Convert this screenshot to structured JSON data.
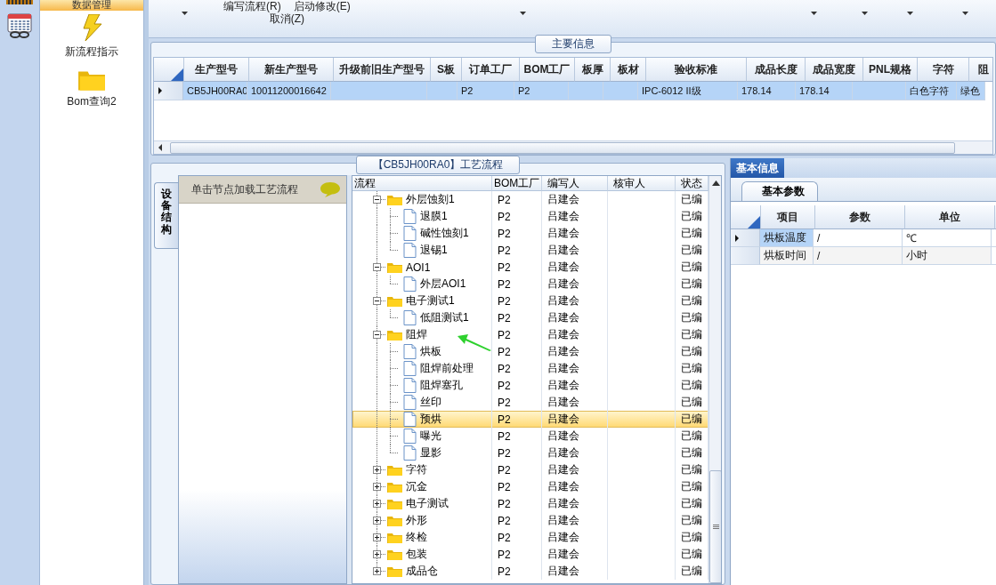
{
  "nav": {
    "header": "数据管理",
    "items": [
      {
        "kind": "bolt",
        "label": "新流程指示"
      },
      {
        "kind": "folder",
        "label": "Bom查询2"
      }
    ]
  },
  "ribbon": {
    "commands": [
      {
        "label": "编写流程(R)"
      },
      {
        "label": "启动修改(E)"
      },
      {
        "label": "取消(Z)"
      }
    ]
  },
  "main_info": {
    "title": "主要信息",
    "columns": [
      "生产型号",
      "新生产型号",
      "升级前旧生产型号",
      "S板",
      "订单工厂",
      "BOM工厂",
      "板厚",
      "板材",
      "验收标准",
      "成品长度",
      "成品宽度",
      "PNL规格",
      "字符",
      "阻"
    ],
    "rows": [
      {
        "selected": true,
        "cells": [
          "CB5JH00RA0",
          "10011200016642",
          "",
          "",
          "P2",
          "P2",
          "",
          "",
          "IPC-6012 II级",
          "178.14",
          "178.14",
          "",
          "白色字符",
          "绿色"
        ]
      }
    ]
  },
  "process": {
    "title": "【CB5JH00RA0】工艺流程",
    "side_tab": "设备结构",
    "hint": "单击节点加载工艺流程",
    "columns": [
      "流程",
      "BOM工厂",
      "编写人",
      "核审人",
      "状态"
    ],
    "tree": [
      {
        "name": "外层蚀刻1",
        "bom": "P2",
        "writer": "吕建会",
        "status": "已编",
        "selected": false,
        "expanded": true,
        "children": [
          {
            "name": "退膜1",
            "bom": "P2",
            "writer": "吕建会",
            "status": "已编",
            "selected": false
          },
          {
            "name": "碱性蚀刻1",
            "bom": "P2",
            "writer": "吕建会",
            "status": "已编",
            "selected": false
          },
          {
            "name": "退锡1",
            "bom": "P2",
            "writer": "吕建会",
            "status": "已编",
            "selected": false
          }
        ]
      },
      {
        "name": "AOI1",
        "bom": "P2",
        "writer": "吕建会",
        "status": "已编",
        "selected": false,
        "expanded": true,
        "children": [
          {
            "name": "外层AOI1",
            "bom": "P2",
            "writer": "吕建会",
            "status": "已编",
            "selected": false
          }
        ]
      },
      {
        "name": "电子测试1",
        "bom": "P2",
        "writer": "吕建会",
        "status": "已编",
        "selected": false,
        "expanded": true,
        "children": [
          {
            "name": "低阻测试1",
            "bom": "P2",
            "writer": "吕建会",
            "status": "已编",
            "selected": false
          }
        ]
      },
      {
        "name": "阻焊",
        "bom": "P2",
        "writer": "吕建会",
        "status": "已编",
        "selected": false,
        "expanded": true,
        "children": [
          {
            "name": "烘板",
            "bom": "P2",
            "writer": "吕建会",
            "status": "已编",
            "selected": false
          },
          {
            "name": "阻焊前处理",
            "bom": "P2",
            "writer": "吕建会",
            "status": "已编",
            "selected": false
          },
          {
            "name": "阻焊塞孔",
            "bom": "P2",
            "writer": "吕建会",
            "status": "已编",
            "selected": false
          },
          {
            "name": "丝印",
            "bom": "P2",
            "writer": "吕建会",
            "status": "已编",
            "selected": false
          },
          {
            "name": "预烘",
            "bom": "P2",
            "writer": "吕建会",
            "status": "已编",
            "selected": true
          },
          {
            "name": "曝光",
            "bom": "P2",
            "writer": "吕建会",
            "status": "已编",
            "selected": false
          },
          {
            "name": "显影",
            "bom": "P2",
            "writer": "吕建会",
            "status": "已编",
            "selected": false
          }
        ]
      },
      {
        "name": "字符",
        "bom": "P2",
        "writer": "吕建会",
        "status": "已编",
        "selected": false,
        "expanded": false
      },
      {
        "name": "沉金",
        "bom": "P2",
        "writer": "吕建会",
        "status": "已编",
        "selected": false,
        "expanded": false
      },
      {
        "name": "电子测试",
        "bom": "P2",
        "writer": "吕建会",
        "status": "已编",
        "selected": false,
        "expanded": false
      },
      {
        "name": "外形",
        "bom": "P2",
        "writer": "吕建会",
        "status": "已编",
        "selected": false,
        "expanded": false
      },
      {
        "name": "终检",
        "bom": "P2",
        "writer": "吕建会",
        "status": "已编",
        "selected": false,
        "expanded": false
      },
      {
        "name": "包装",
        "bom": "P2",
        "writer": "吕建会",
        "status": "已编",
        "selected": false,
        "expanded": false
      },
      {
        "name": "成品仓",
        "bom": "P2",
        "writer": "吕建会",
        "status": "已编",
        "selected": false,
        "expanded": false
      }
    ]
  },
  "detail": {
    "tabs": [
      {
        "label": "基本信息",
        "selected": true
      }
    ],
    "subtabs": [
      {
        "label": "基本参数",
        "selected": true
      }
    ],
    "columns": [
      "项目",
      "参数",
      "单位"
    ],
    "rows": [
      {
        "selected": true,
        "cells": [
          "烘板温度",
          "/",
          "℃"
        ]
      },
      {
        "selected": false,
        "cells": [
          "烘板时间",
          "/",
          "小时"
        ]
      }
    ]
  }
}
